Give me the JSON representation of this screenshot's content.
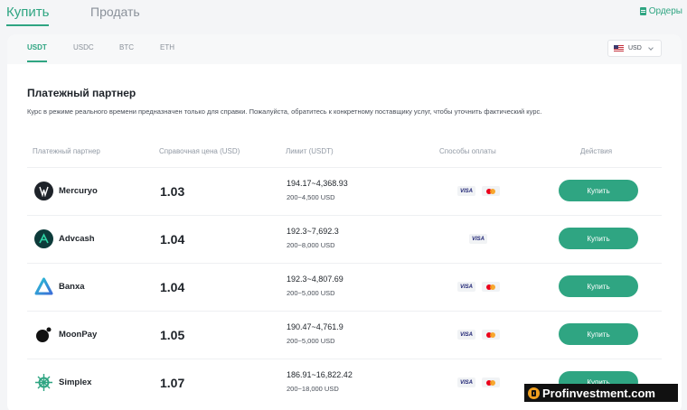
{
  "top_tabs": {
    "buy": "Купить",
    "sell": "Продать"
  },
  "orders_label": "Ордеры",
  "coin_tabs": [
    "USDT",
    "USDC",
    "BTC",
    "ETH"
  ],
  "currency": "USD",
  "section": {
    "title": "Платежный партнер",
    "subtitle": "Курс в режиме реального времени предназначен только для справки. Пожалуйста, обратитесь к конкретному поставщику услуг, чтобы уточнить фактический курс."
  },
  "table": {
    "headers": [
      "Платежный партнер",
      "Справочная цена (USD)",
      "Лимит (USDT)",
      "Способы оплаты",
      "Действия"
    ],
    "rows": [
      {
        "name": "Mercuryo",
        "price": "1.03",
        "limit": "194.17~4,368.93",
        "limit_usd": "200~4,500 USD",
        "methods": [
          "VISA",
          "mastercard"
        ],
        "action": "Купить"
      },
      {
        "name": "Advcash",
        "price": "1.04",
        "limit": "192.3~7,692.3",
        "limit_usd": "200~8,000 USD",
        "methods": [
          "VISA"
        ],
        "action": "Купить"
      },
      {
        "name": "Banxa",
        "price": "1.04",
        "limit": "192.3~4,807.69",
        "limit_usd": "200~5,000 USD",
        "methods": [
          "VISA",
          "mastercard"
        ],
        "action": "Купить"
      },
      {
        "name": "MoonPay",
        "price": "1.05",
        "limit": "190.47~4,761.9",
        "limit_usd": "200~5,000 USD",
        "methods": [
          "VISA",
          "mastercard"
        ],
        "action": "Купить"
      },
      {
        "name": "Simplex",
        "price": "1.07",
        "limit": "186.91~16,822.42",
        "limit_usd": "200~18,000 USD",
        "methods": [
          "VISA",
          "mastercard"
        ],
        "action": "Купить"
      }
    ]
  },
  "watermark": "Profinvestment.com",
  "colors": {
    "accent": "#2fa582",
    "background": "#f4f5f7"
  }
}
